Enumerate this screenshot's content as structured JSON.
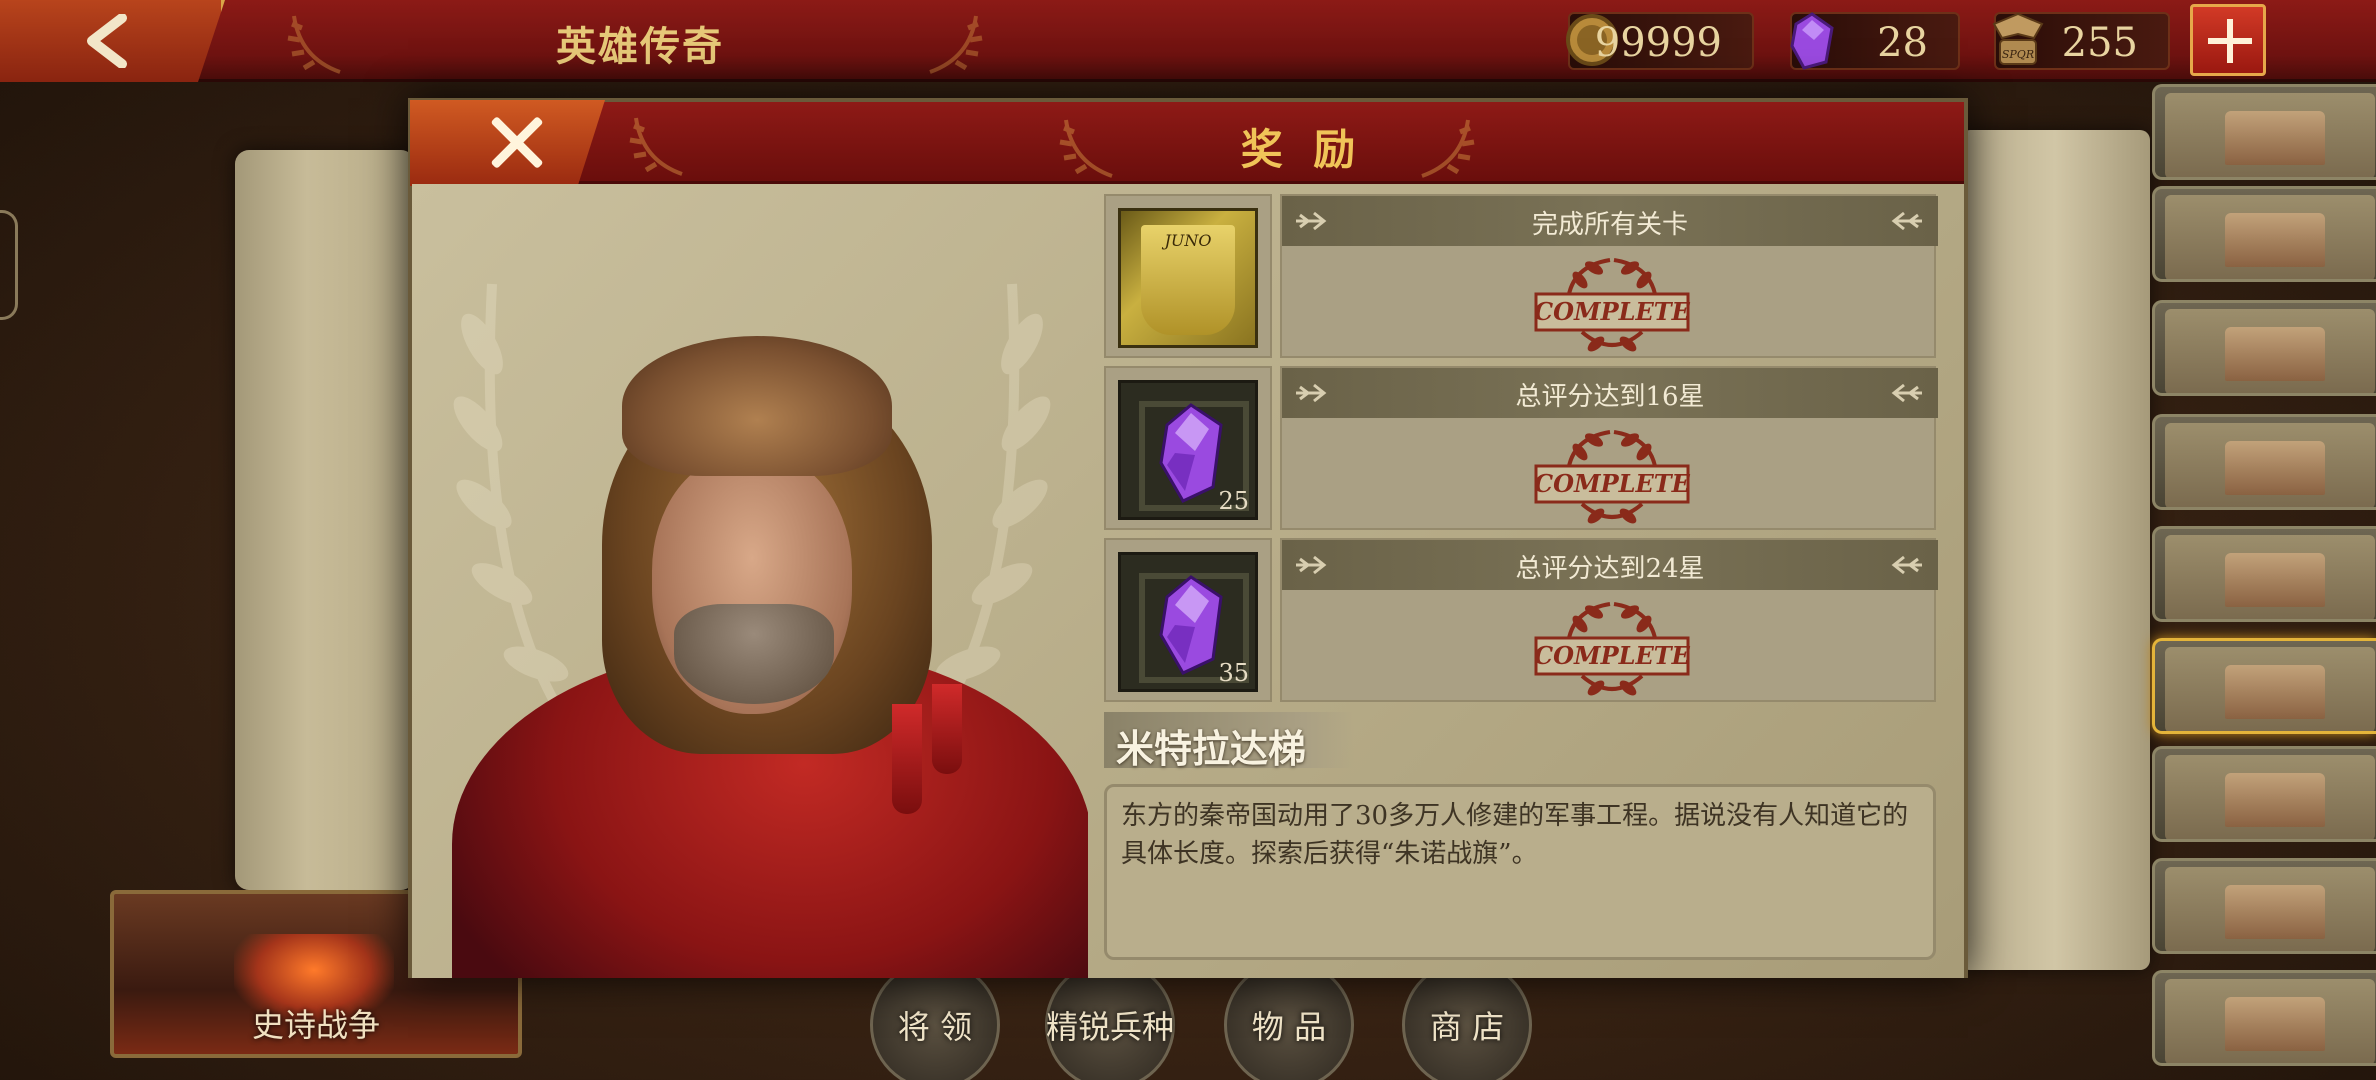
{
  "topbar": {
    "title": "英雄传奇",
    "back_icon": "chevron-left-icon",
    "resources": [
      {
        "name": "gold",
        "icon": "gold-coin-icon",
        "value": "99999"
      },
      {
        "name": "gem",
        "icon": "purple-gem-icon",
        "value": "28"
      },
      {
        "name": "spqr",
        "icon": "spqr-eagle-icon",
        "value": "255"
      }
    ],
    "add_icon": "plus-icon"
  },
  "modal": {
    "title": "奖 励",
    "close_icon": "close-icon",
    "rewards": [
      {
        "condition": "完成所有关卡",
        "item_icon": "juno-banner-icon",
        "item_label": "JUNO",
        "quantity": "",
        "status": "COMPLETE"
      },
      {
        "condition": "总评分达到16星",
        "item_icon": "purple-gem-icon",
        "item_label": "",
        "quantity": "25",
        "status": "COMPLETE"
      },
      {
        "condition": "总评分达到24星",
        "item_icon": "purple-gem-icon",
        "item_label": "",
        "quantity": "35",
        "status": "COMPLETE"
      }
    ],
    "site_name": "米特拉达梯",
    "description": "东方的秦帝国动用了30多万人修建的军事工程。据说没有人知道它的具体长度。探索后获得“朱诺战旗”。"
  },
  "bottom_nav": {
    "epic_war": "史诗战争",
    "buttons": [
      "将 领",
      "精锐兵种",
      "物 品",
      "商 店"
    ]
  },
  "buildings": [
    "fortress",
    "castle-walls",
    "colosseum",
    "ruins-columns",
    "garden-temple",
    "great-wall",
    "petra",
    "parthenon",
    "pyramids"
  ],
  "colors": {
    "header_red": "#7a1412",
    "gold_text": "#f0c458",
    "parchment": "#b9ae8c",
    "stamp_red": "#8a2a1a",
    "gem_purple": "#9a4ae0"
  }
}
